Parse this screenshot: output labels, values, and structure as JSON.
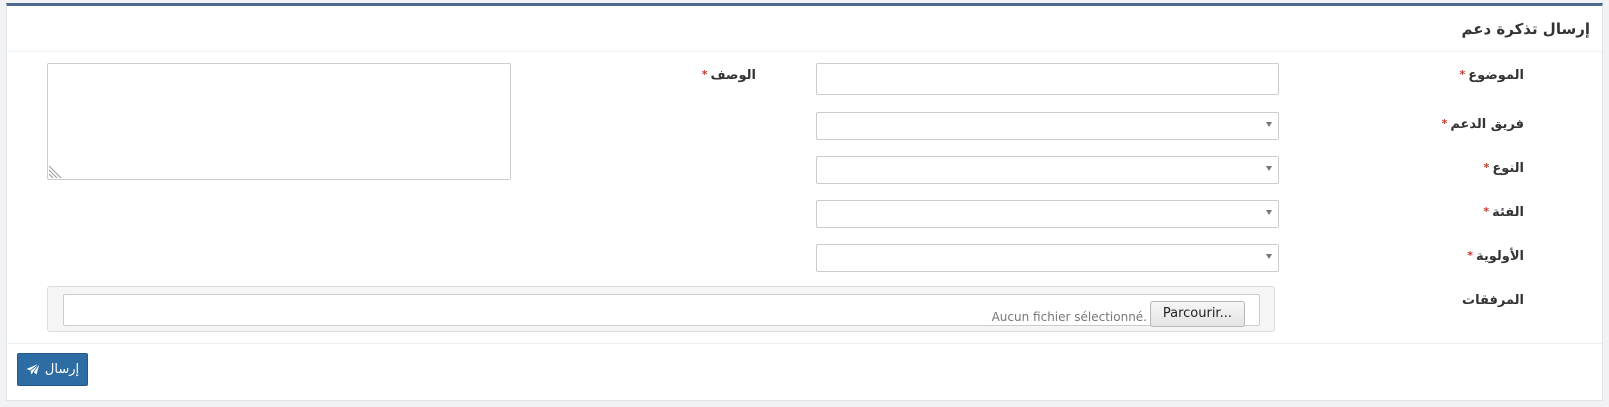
{
  "panel": {
    "title": "إرسال تذكرة دعم"
  },
  "form": {
    "required_mark": "*",
    "subject": {
      "label": "الموضوع",
      "value": ""
    },
    "support_team": {
      "label": "فريق الدعم",
      "selected": ""
    },
    "type": {
      "label": "النوع",
      "selected": ""
    },
    "category": {
      "label": "الفئة",
      "selected": ""
    },
    "priority": {
      "label": "الأولوية",
      "selected": ""
    },
    "attachments": {
      "label": "المرفقات",
      "browse_label": "Parcourir...",
      "status_text": "Aucun fichier sélectionné."
    },
    "description": {
      "label": "الوصف",
      "value": ""
    }
  },
  "actions": {
    "submit_label": "إرسال",
    "submit_icon": "paper-plane-icon"
  },
  "colors": {
    "accent": "#2e6da4",
    "required": "#c0392b",
    "top_border": "#4a6b8f"
  }
}
